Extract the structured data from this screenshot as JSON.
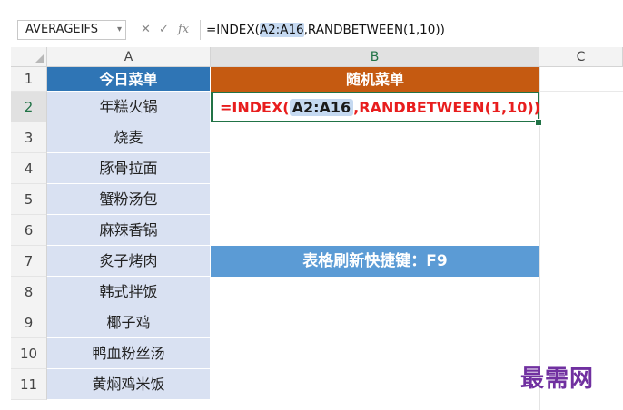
{
  "formula_bar": {
    "name_box": "AVERAGEIFS",
    "cancel_icon": "✕",
    "enter_icon": "✓",
    "fx_label": "fx",
    "formula_prefix": "=INDEX(",
    "formula_ref": "A2:A16",
    "formula_suffix": ",RANDBETWEEN(1,10))"
  },
  "columns": [
    "A",
    "B",
    "C"
  ],
  "rows": [
    "1",
    "2",
    "3",
    "4",
    "5",
    "6",
    "7",
    "8",
    "9",
    "10",
    "11"
  ],
  "sheet": {
    "a_header": "今日菜单",
    "b_header": "随机菜单",
    "menu_items": [
      "年糕火锅",
      "烧麦",
      "豚骨拉面",
      "蟹粉汤包",
      "麻辣香锅",
      "炙子烤肉",
      "韩式拌饭",
      "椰子鸡",
      "鸭血粉丝汤",
      "黄焖鸡米饭"
    ],
    "b2_prefix": "=INDEX(",
    "b2_ref": "A2:A16",
    "b2_suffix": ",RANDBETWEEN(1,10))",
    "banner": "表格刷新快捷键：F9"
  },
  "watermark": "最需网",
  "colors": {
    "a_header_bg": "#2f75b5",
    "b_header_bg": "#c55a11",
    "a_cells_bg": "#d9e1f2",
    "banner_bg": "#5b9bd5",
    "formula_text": "#e81d1d",
    "selection": "#217346"
  }
}
